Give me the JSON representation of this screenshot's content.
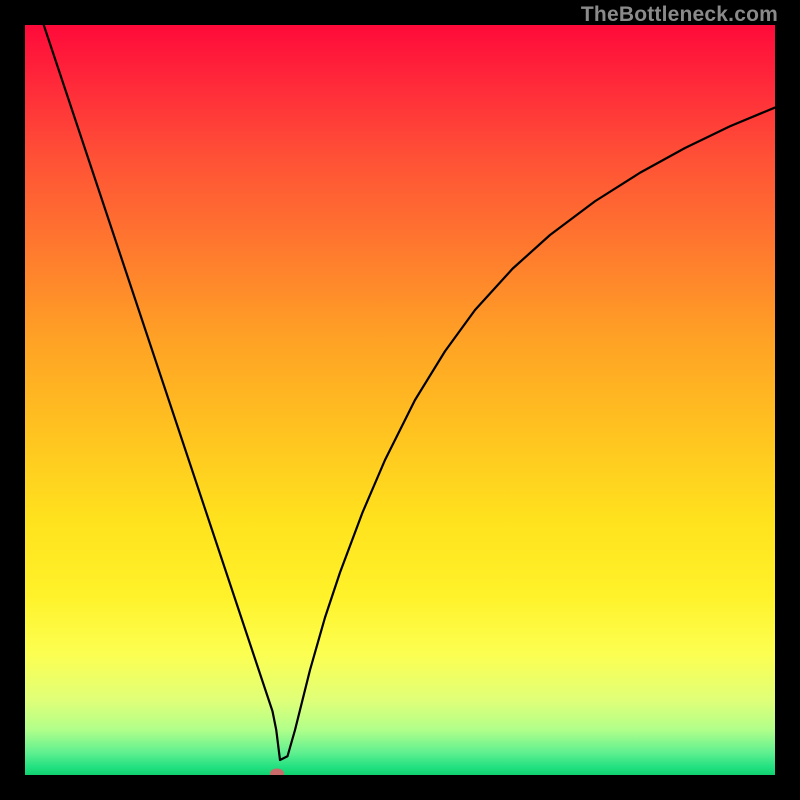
{
  "attribution": "TheBottleneck.com",
  "chart_data": {
    "type": "line",
    "title": "",
    "xlabel": "",
    "ylabel": "",
    "xlim": [
      0,
      100
    ],
    "ylim": [
      0,
      100
    ],
    "x": [
      0,
      1.5,
      3,
      5,
      7,
      10,
      13,
      16,
      19,
      22,
      25,
      27,
      29,
      31,
      32,
      33,
      33.5,
      34,
      35,
      36,
      37,
      38,
      40,
      42,
      45,
      48,
      52,
      56,
      60,
      65,
      70,
      76,
      82,
      88,
      94,
      100
    ],
    "y": [
      108,
      103,
      98.5,
      92.5,
      86.5,
      77.5,
      68.5,
      59.5,
      50.5,
      41.5,
      32.5,
      26.5,
      20.5,
      14.5,
      11.5,
      8.5,
      6,
      2,
      2.5,
      6,
      10,
      14,
      21,
      27,
      35,
      42,
      50,
      56.5,
      62,
      67.5,
      72,
      76.5,
      80.3,
      83.6,
      86.5,
      89
    ],
    "marker": {
      "x": 33.6,
      "y": 0.2
    },
    "gradient_stops": [
      {
        "pos": 0,
        "color": "#ff0a3a"
      },
      {
        "pos": 0.3,
        "color": "#ff7a2e"
      },
      {
        "pos": 0.6,
        "color": "#ffe21e"
      },
      {
        "pos": 0.85,
        "color": "#fcff52"
      },
      {
        "pos": 1.0,
        "color": "#10d070"
      }
    ]
  }
}
